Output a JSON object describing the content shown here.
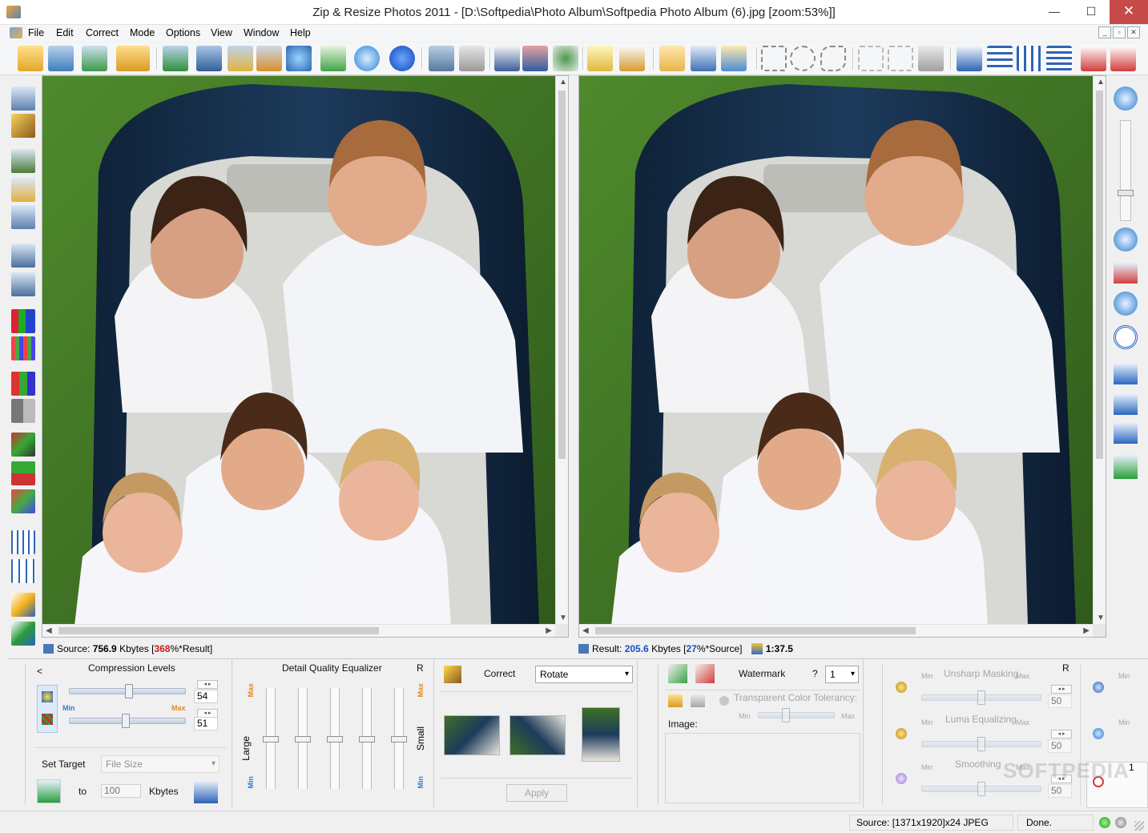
{
  "window": {
    "title": "Zip & Resize Photos 2011 - [D:\\Softpedia\\Photo Album\\Softpedia Photo Album (6).jpg  [zoom:53%]]",
    "minimize": "—",
    "maximize": "☐",
    "close": "✕"
  },
  "menu": [
    "File",
    "Edit",
    "Correct",
    "Mode",
    "Options",
    "View",
    "Window",
    "Help"
  ],
  "mdi_controls": [
    "_",
    "▫",
    "✕"
  ],
  "source_info": {
    "label": "Source:",
    "size": "756.9",
    "unit": "Kbytes",
    "open_bracket": "[",
    "ratio": "368",
    "ratio_suffix": "%*Result]"
  },
  "result_info": {
    "label": "Result:",
    "size": "205.6",
    "unit": "Kbytes",
    "open_bracket": "[",
    "ratio": "27",
    "ratio_suffix": "%*Source]",
    "compression": "1:37.5"
  },
  "compression": {
    "collapse": "<",
    "title": "Compression Levels",
    "min": "Min",
    "max": "Max",
    "value1": "54",
    "value2": "51",
    "slider1_level": 0.7,
    "slider2_level": 0.65,
    "set_target_label": "Set Target",
    "target_type": "File Size",
    "to_label": "to",
    "target_value": "100",
    "target_unit": "Kbytes"
  },
  "equalizer": {
    "title": "Detail Quality Equalizer",
    "r": "R",
    "max": "Max",
    "min": "Min",
    "large": "Large",
    "small": "Small"
  },
  "correct": {
    "label": "Correct",
    "action": "Rotate",
    "apply": "Apply"
  },
  "watermark": {
    "label": "Watermark",
    "help": "?",
    "value": "1",
    "tolerance_label": "Transparent Color Tolerancy:",
    "min": "Min",
    "max": "Max",
    "image_label": "Image:"
  },
  "filters": {
    "r": "R",
    "min": "Min",
    "max": "Max",
    "unsharp": "Unsharp Masking",
    "luma": "Luma Equalizing",
    "smoothing": "Smoothing",
    "v1": "50",
    "v2": "50",
    "v3": "50",
    "right_min": "Min",
    "right_value": "1"
  },
  "status": {
    "source": "Source: [1371x1920]x24 JPEG",
    "state": "Done."
  },
  "watermark_text": "SOFTPEDIA"
}
